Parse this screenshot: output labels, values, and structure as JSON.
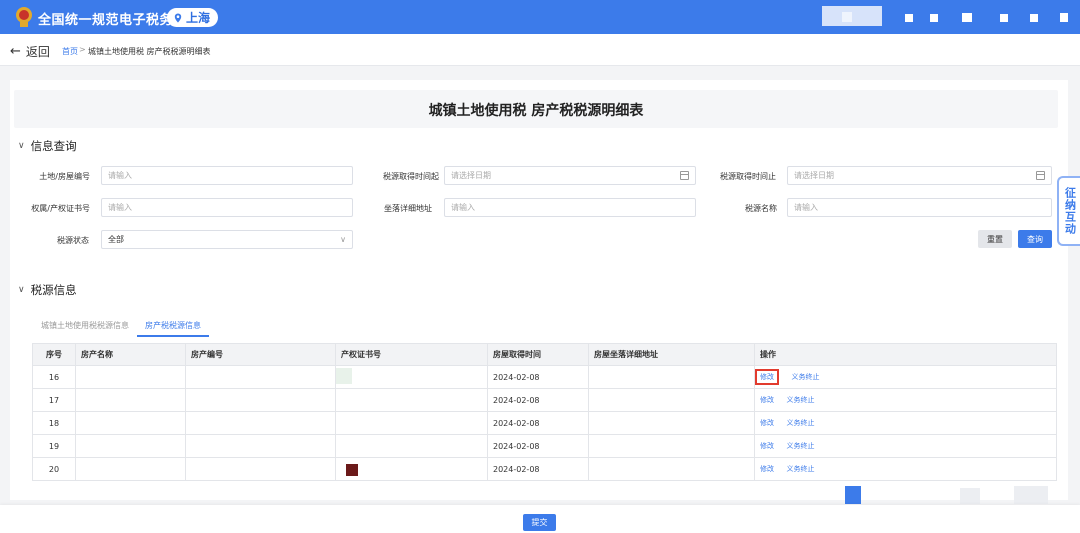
{
  "header": {
    "app_title": "全国统一规范电子税务局",
    "region": "上海",
    "emblem_icon": "tax-emblem-icon"
  },
  "breadcrumb": {
    "back_label": "返回",
    "home": "首页",
    "separator": ">",
    "current": "城镇土地使用税 房产税税源明细表"
  },
  "page": {
    "title": "城镇土地使用税 房产税税源明细表"
  },
  "query": {
    "section_title": "信息查询",
    "fields": {
      "land_no": {
        "label": "土地/房屋编号",
        "placeholder": "请输入"
      },
      "acq_start": {
        "label": "税源取得时间起",
        "placeholder": "请选择日期"
      },
      "acq_end": {
        "label": "税源取得时间止",
        "placeholder": "请选择日期"
      },
      "cert_no": {
        "label": "权属/产权证书号",
        "placeholder": "请输入"
      },
      "address": {
        "label": "坐落详细地址",
        "placeholder": "请输入"
      },
      "source_name": {
        "label": "税源名称",
        "placeholder": "请输入"
      },
      "status": {
        "label": "税源状态",
        "value": "全部"
      }
    },
    "reset_label": "重置",
    "search_label": "查询"
  },
  "source": {
    "section_title": "税源信息",
    "tabs": [
      {
        "label": "城镇土地使用税税源信息",
        "active": false
      },
      {
        "label": "房产税税源信息",
        "active": true
      }
    ],
    "columns": [
      "序号",
      "房产名称",
      "房产编号",
      "产权证书号",
      "房屋取得时间",
      "房屋坐落详细地址",
      "操作"
    ],
    "rows": [
      {
        "no": "16",
        "date": "2024-02-08",
        "edit": "修改",
        "stop": "义务终止"
      },
      {
        "no": "17",
        "date": "2024-02-08",
        "edit": "修改",
        "stop": "义务终止"
      },
      {
        "no": "18",
        "date": "2024-02-08",
        "edit": "修改",
        "stop": "义务终止"
      },
      {
        "no": "19",
        "date": "2024-02-08",
        "edit": "修改",
        "stop": "义务终止"
      },
      {
        "no": "20",
        "date": "2024-02-08",
        "edit": "修改",
        "stop": "义务终止"
      }
    ]
  },
  "float_tab": {
    "label": "征纳互动"
  },
  "footer": {
    "submit_label": "提交"
  },
  "colors": {
    "primary": "#3c7bea",
    "highlight": "#e23b2e"
  }
}
